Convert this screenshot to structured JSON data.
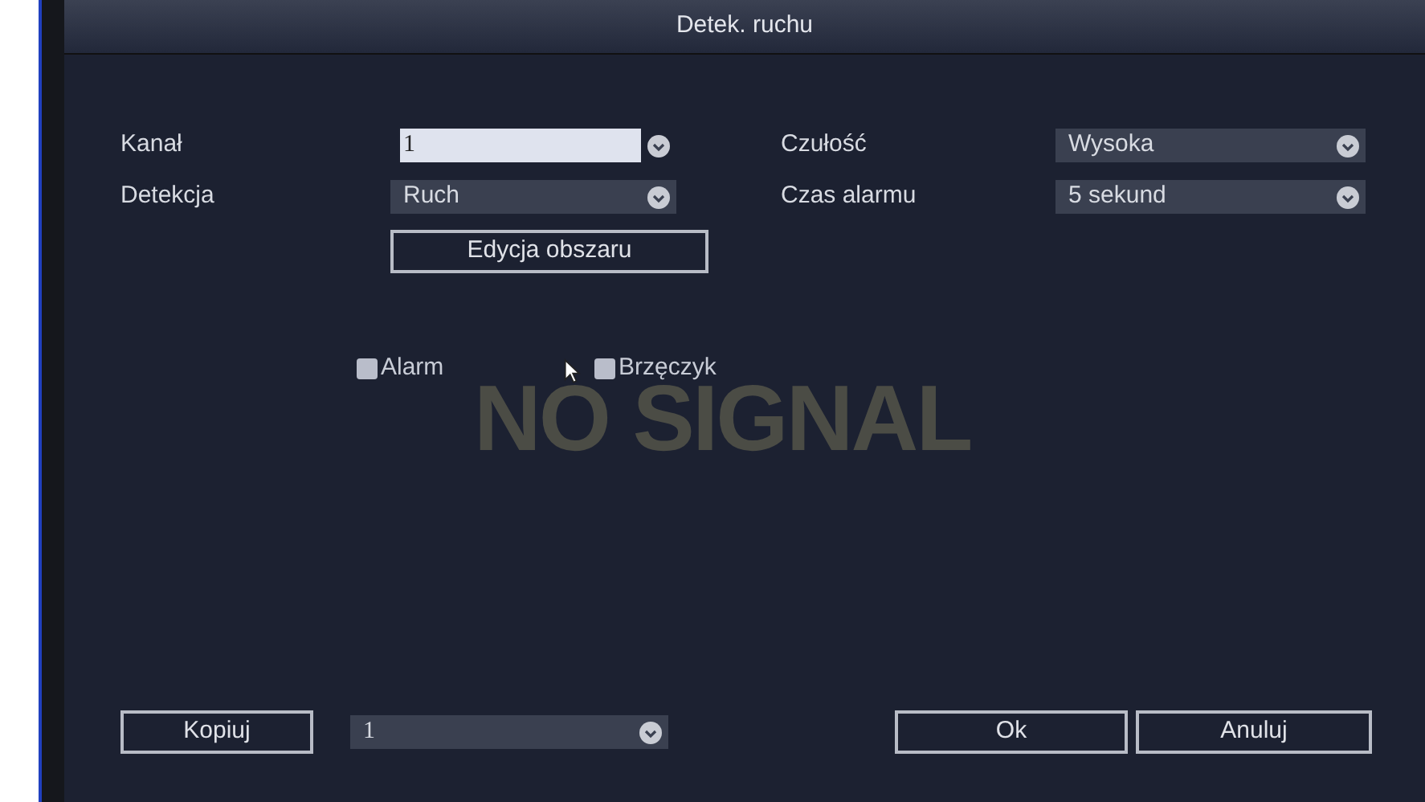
{
  "window": {
    "title": "Detek. ruchu"
  },
  "settings": [
    {
      "label": "Kanał",
      "value": "1",
      "focused": true
    },
    {
      "label": "Czułość",
      "value": "Wysoka",
      "focused": false
    },
    {
      "label": "Detekcja",
      "value": "Ruch",
      "focused": false
    },
    {
      "label": "Czas alarmu",
      "value": "5 sekund",
      "focused": false
    }
  ],
  "area_button": "Edycja obszaru",
  "checkboxes": [
    {
      "label": "Alarm",
      "checked": false
    },
    {
      "label": "Brzęczyk",
      "checked": false
    }
  ],
  "overlay": "NO SIGNAL",
  "footer": {
    "copy_button": "Kopiuj",
    "copy_channel": "1",
    "ok_button": "Ok",
    "cancel_button": "Anuluj"
  }
}
